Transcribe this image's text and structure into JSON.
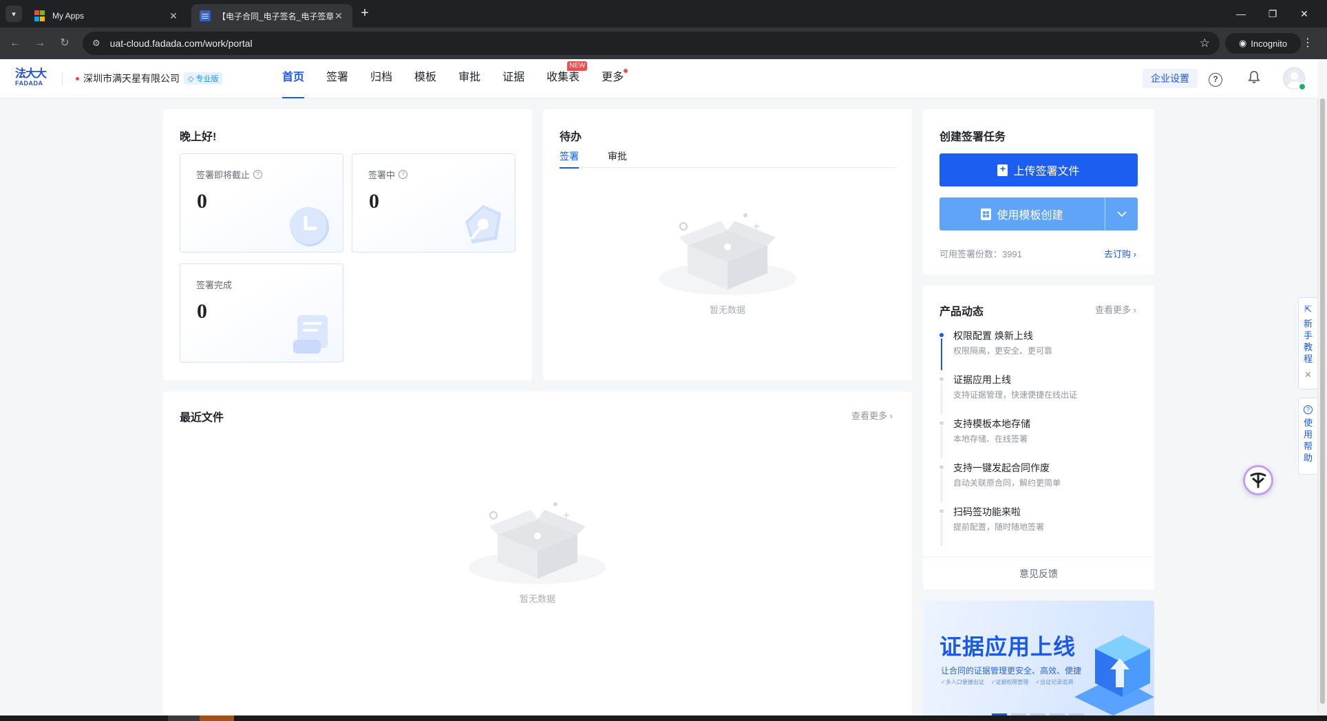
{
  "browser": {
    "tabs": [
      {
        "title": "My Apps",
        "active": false
      },
      {
        "title": "【电子合同_电子签名_电子签章】",
        "active": true
      }
    ],
    "url": "uat-cloud.fadada.com/work/portal",
    "incognito_label": "Incognito"
  },
  "header": {
    "logo_cn": "法大大",
    "logo_en": "FADADA",
    "company": "深圳市满天星有限公司",
    "edition": "专业版",
    "nav": [
      "首页",
      "签署",
      "归档",
      "模板",
      "审批",
      "证据",
      "收集表",
      "更多"
    ],
    "active_nav": "首页",
    "new_badge": "NEW",
    "enterprise_settings": "企业设置",
    "help_glyph": "?"
  },
  "greeting": {
    "title": "晚上好!",
    "stats": [
      {
        "label": "签署即将截止",
        "value": "0",
        "has_help": true,
        "icon": "clock-icon"
      },
      {
        "label": "签署中",
        "value": "0",
        "has_help": true,
        "icon": "pen-icon"
      },
      {
        "label": "签署完成",
        "value": "0",
        "has_help": false,
        "icon": "scroll-icon"
      }
    ]
  },
  "todo": {
    "title": "待办",
    "tabs": [
      "签署",
      "审批"
    ],
    "active_tab": "签署",
    "empty_text": "暂无数据"
  },
  "recent": {
    "title": "最近文件",
    "more": "查看更多",
    "empty_text": "暂无数据"
  },
  "create": {
    "title": "创建签署任务",
    "upload_button": "上传签署文件",
    "template_button": "使用模板创建",
    "quota_label": "可用签署份数：",
    "quota_value": "3991",
    "subscribe": "去订购"
  },
  "product_news": {
    "title": "产品动态",
    "more": "查看更多",
    "items": [
      {
        "title": "权限配置 焕新上线",
        "desc": "权限隔离，更安全、更可靠"
      },
      {
        "title": "证据应用上线",
        "desc": "支持证据管理，快速便捷在线出证"
      },
      {
        "title": "支持模板本地存储",
        "desc": "本地存储、在线签署"
      },
      {
        "title": "支持一键发起合同作废",
        "desc": "自动关联原合同，解约更简单"
      },
      {
        "title": "扫码签功能来啦",
        "desc": "提前配置，随时随地签署"
      }
    ],
    "feedback": "意见反馈"
  },
  "banner": {
    "title": "证据应用上线",
    "subtitle": "让合同的证据管理更安全、高效、便捷",
    "features": [
      "多人口便捷出证",
      "证据权限管理",
      "出证记录追溯"
    ]
  },
  "side": {
    "tutorial": "新手教程",
    "help": "使用帮助"
  },
  "colors": {
    "brand": "#1a58e8",
    "upload_button": "#1a5ff0",
    "template_button": "#5fa4f7",
    "badge_red": "#f24d4d"
  }
}
